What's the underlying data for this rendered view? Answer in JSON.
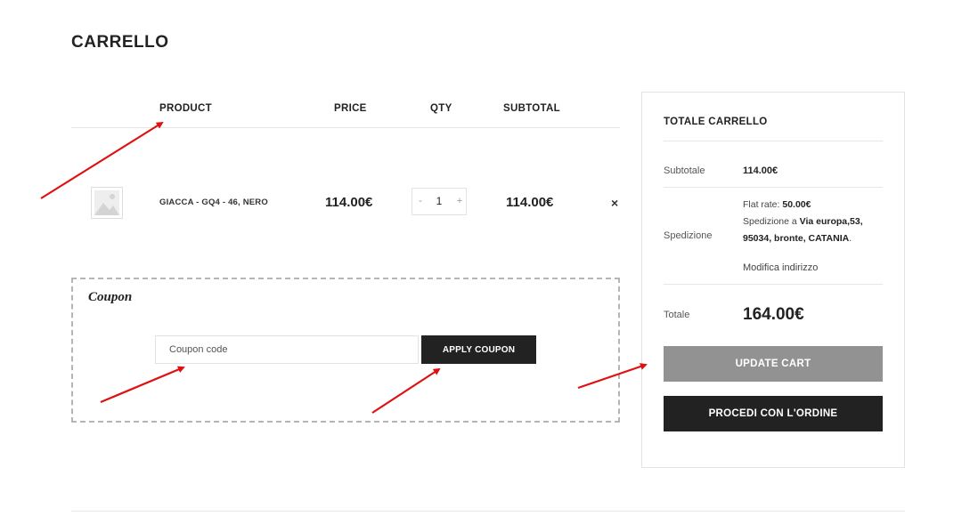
{
  "page": {
    "title": "CARRELLO"
  },
  "table": {
    "headers": {
      "product": "PRODUCT",
      "price": "PRICE",
      "qty": "QTY",
      "subtotal": "SUBTOTAL"
    },
    "rows": [
      {
        "name": "GIACCA - GQ4 - 46, NERO",
        "price": "114.00€",
        "qty_minus": "-",
        "qty": "1",
        "qty_plus": "+",
        "subtotal": "114.00€",
        "remove": "×"
      }
    ]
  },
  "coupon": {
    "title": "Coupon",
    "placeholder": "Coupon code",
    "apply_label": "APPLY COUPON"
  },
  "totals": {
    "title": "TOTALE CARRELLO",
    "subtotal_label": "Subtotale",
    "subtotal_value": "114.00€",
    "shipping_label": "Spedizione",
    "shipping_rate_label": "Flat rate: ",
    "shipping_rate_value": "50.00€",
    "shipping_to_prefix": "Spedizione a ",
    "shipping_address_1": "Via europa,53,",
    "shipping_address_2": "95034, bronte, CATANIA",
    "shipping_address_suffix": ".",
    "change_address": "Modifica indirizzo",
    "total_label": "Totale",
    "total_value": "164.00€",
    "update_label": "UPDATE CART",
    "checkout_label": "PROCEDI CON L'ORDINE"
  },
  "colors": {
    "arrow": "#e01010",
    "dark_button": "#222222",
    "update_button": "#929292"
  },
  "icons": {
    "product_thumb": "image-placeholder-icon",
    "remove": "close-icon"
  }
}
